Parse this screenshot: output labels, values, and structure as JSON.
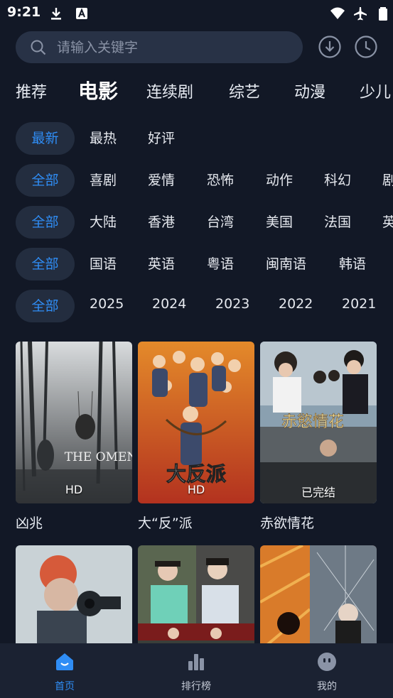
{
  "status_bar": {
    "time": "9:21",
    "icons": [
      "download-icon",
      "autofill-icon",
      "wifi-icon",
      "airplane-icon",
      "battery-icon"
    ]
  },
  "search": {
    "placeholder": "请输入关键字",
    "value": ""
  },
  "header_actions": [
    "download-icon",
    "history-clock-icon"
  ],
  "tabs": [
    {
      "label": "推荐",
      "active": false
    },
    {
      "label": "电影",
      "active": true
    },
    {
      "label": "连续剧",
      "active": false
    },
    {
      "label": "综艺",
      "active": false
    },
    {
      "label": "动漫",
      "active": false
    },
    {
      "label": "少儿",
      "active": false
    }
  ],
  "filters": {
    "sort": [
      "最新",
      "最热",
      "好评"
    ],
    "genre": [
      "全部",
      "喜剧",
      "爱情",
      "恐怖",
      "动作",
      "科幻",
      "剧"
    ],
    "region": [
      "全部",
      "大陆",
      "香港",
      "台湾",
      "美国",
      "法国",
      "英"
    ],
    "language": [
      "全部",
      "国语",
      "英语",
      "粤语",
      "闽南语",
      "韩语"
    ],
    "year": [
      "全部",
      "2025",
      "2024",
      "2023",
      "2022",
      "2021"
    ]
  },
  "movies": [
    {
      "title": "凶兆",
      "badge": "HD",
      "poster_text": "THE OMEN"
    },
    {
      "title": "大“反”派",
      "badge": "HD",
      "poster_text": "大反派"
    },
    {
      "title": "赤欲情花",
      "badge": "已完结",
      "poster_text": "赤慾情花"
    },
    {
      "title": "",
      "badge": "",
      "poster_text": ""
    },
    {
      "title": "",
      "badge": "",
      "poster_text": ""
    },
    {
      "title": "",
      "badge": "",
      "poster_text": ""
    }
  ],
  "bottom_nav": [
    {
      "label": "首页",
      "icon": "home-icon",
      "active": true
    },
    {
      "label": "排行榜",
      "icon": "ranking-icon",
      "active": false
    },
    {
      "label": "我的",
      "icon": "profile-icon",
      "active": false
    }
  ],
  "colors": {
    "background": "#121826",
    "accent": "#2f8df5",
    "chip_bg": "#232d3f",
    "nav_bg": "#1b2232"
  }
}
